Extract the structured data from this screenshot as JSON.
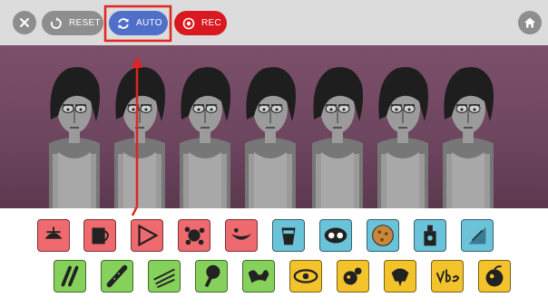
{
  "toolbar": {
    "close_icon": "close-icon",
    "reset_label": "RESET",
    "reset_icon": "reset-icon",
    "auto_label": "AUTO",
    "auto_icon": "refresh-icon",
    "rec_label": "REC",
    "rec_icon": "record-icon",
    "home_icon": "home-icon"
  },
  "colors": {
    "toolbar_bg": "#dcdcdc",
    "reset_bg": "#8e8e8e",
    "auto_bg": "#4f6fc8",
    "rec_bg": "#d9191f",
    "stage_bg": "#7c4f69",
    "highlight": "#e0241f",
    "beats": "#ee6a6f",
    "effects": "#6bc3d9",
    "melodies": "#86d15b",
    "voices": "#f3c32c"
  },
  "stage": {
    "characters": [
      {
        "name": "character-1",
        "state": "idle"
      },
      {
        "name": "character-2",
        "state": "idle"
      },
      {
        "name": "character-3",
        "state": "idle"
      },
      {
        "name": "character-4",
        "state": "idle"
      },
      {
        "name": "character-5",
        "state": "idle"
      },
      {
        "name": "character-6",
        "state": "idle"
      },
      {
        "name": "character-7",
        "state": "idle"
      }
    ]
  },
  "sound_palette": {
    "row1": [
      {
        "icon": "propeller-cap-icon",
        "category": "beats"
      },
      {
        "icon": "mug-icon",
        "category": "beats"
      },
      {
        "icon": "play-triangle-icon",
        "category": "beats"
      },
      {
        "icon": "gear-splat-icon",
        "category": "beats"
      },
      {
        "icon": "mouth-icon",
        "category": "beats"
      },
      {
        "icon": "cup-icon",
        "category": "effects"
      },
      {
        "icon": "eyes-mask-icon",
        "category": "effects"
      },
      {
        "icon": "cookie-icon",
        "category": "effects"
      },
      {
        "icon": "bottle-icon",
        "category": "effects"
      },
      {
        "icon": "flag-icon",
        "category": "effects"
      }
    ],
    "row2": [
      {
        "icon": "two-sticks-icon",
        "category": "melodies"
      },
      {
        "icon": "flute-icon",
        "category": "melodies"
      },
      {
        "icon": "scribble-lines-icon",
        "category": "melodies"
      },
      {
        "icon": "tree-icon",
        "category": "melodies"
      },
      {
        "icon": "graffiti-icon",
        "category": "melodies"
      },
      {
        "icon": "eye-icon",
        "category": "voices"
      },
      {
        "icon": "bird-icon",
        "category": "voices"
      },
      {
        "icon": "bell-icon",
        "category": "voices"
      },
      {
        "icon": "vbe-lettering-icon",
        "category": "voices"
      },
      {
        "icon": "fruit-icon",
        "category": "voices"
      }
    ]
  },
  "annotation": {
    "highlighted_control": "auto-button"
  }
}
